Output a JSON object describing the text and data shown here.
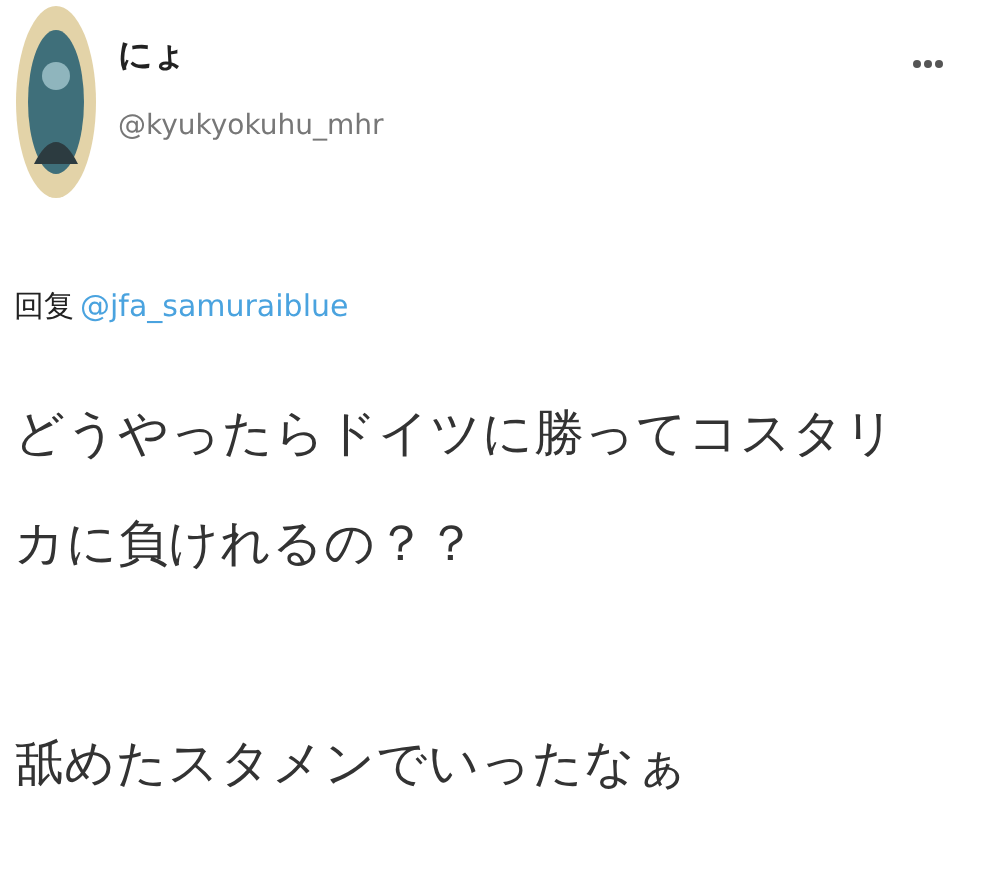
{
  "author": {
    "name": "にょ",
    "handle": "@kyukyokuhu_mhr"
  },
  "reply_to": {
    "prefix": "回复",
    "handle": "@jfa_samuraiblue"
  },
  "paragraphs": [
    "どうやったらドイツに勝ってコスタリカに負けれるの？？",
    "舐めたスタメンでいったなぁ"
  ]
}
